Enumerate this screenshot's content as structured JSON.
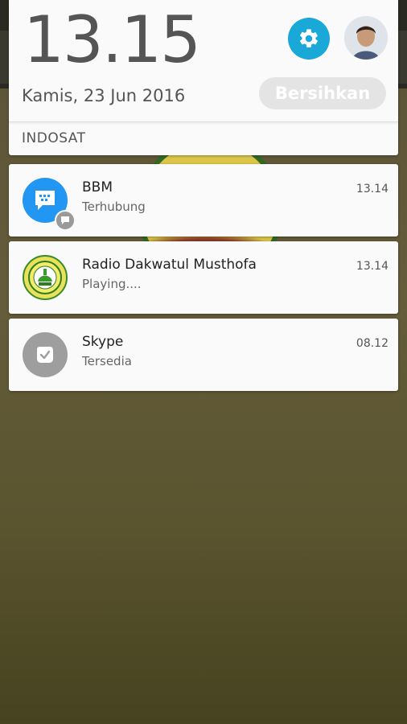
{
  "header": {
    "time": "13.15",
    "date": "Kamis, 23 Jun 2016",
    "clear_label": "Bersihkan",
    "carrier": "INDOSAT"
  },
  "colors": {
    "settings_bg": "#1aa8d8",
    "bbm_bg": "#2196f3",
    "skype_bg": "#9e9e9e",
    "radio_bg": "#e8e25a"
  },
  "icons": {
    "settings": "gear-icon",
    "avatar": "user-avatar",
    "bbm": "bbm-chat-icon",
    "bbm_badge": "message-badge-icon",
    "radio": "radio-logo-icon",
    "skype": "skype-icon"
  },
  "notifications": [
    {
      "app": "BBM",
      "text": "Terhubung",
      "time": "13.14"
    },
    {
      "app": "Radio Dakwatul Musthofa",
      "text": "Playing....",
      "time": "13.14"
    },
    {
      "app": "Skype",
      "text": "Tersedia",
      "time": "08.12"
    }
  ]
}
